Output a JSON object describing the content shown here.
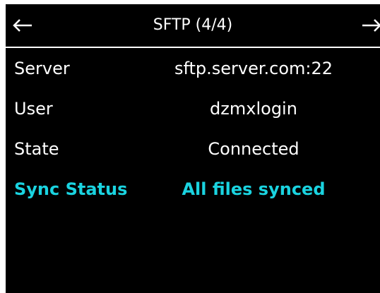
{
  "header": {
    "title": "SFTP (4/4)",
    "prev_icon": "arrow-left-icon",
    "next_icon": "arrow-right-icon"
  },
  "rows": [
    {
      "label": "Server",
      "value": "sftp.server.com:22"
    },
    {
      "label": "User",
      "value": "dzmxlogin"
    },
    {
      "label": "State",
      "value": "Connected"
    },
    {
      "label": "Sync Status",
      "value": "All files synced",
      "highlighted": true
    }
  ],
  "colors": {
    "background": "#000000",
    "text": "#ffffff",
    "highlight": "#1ad3e0"
  }
}
